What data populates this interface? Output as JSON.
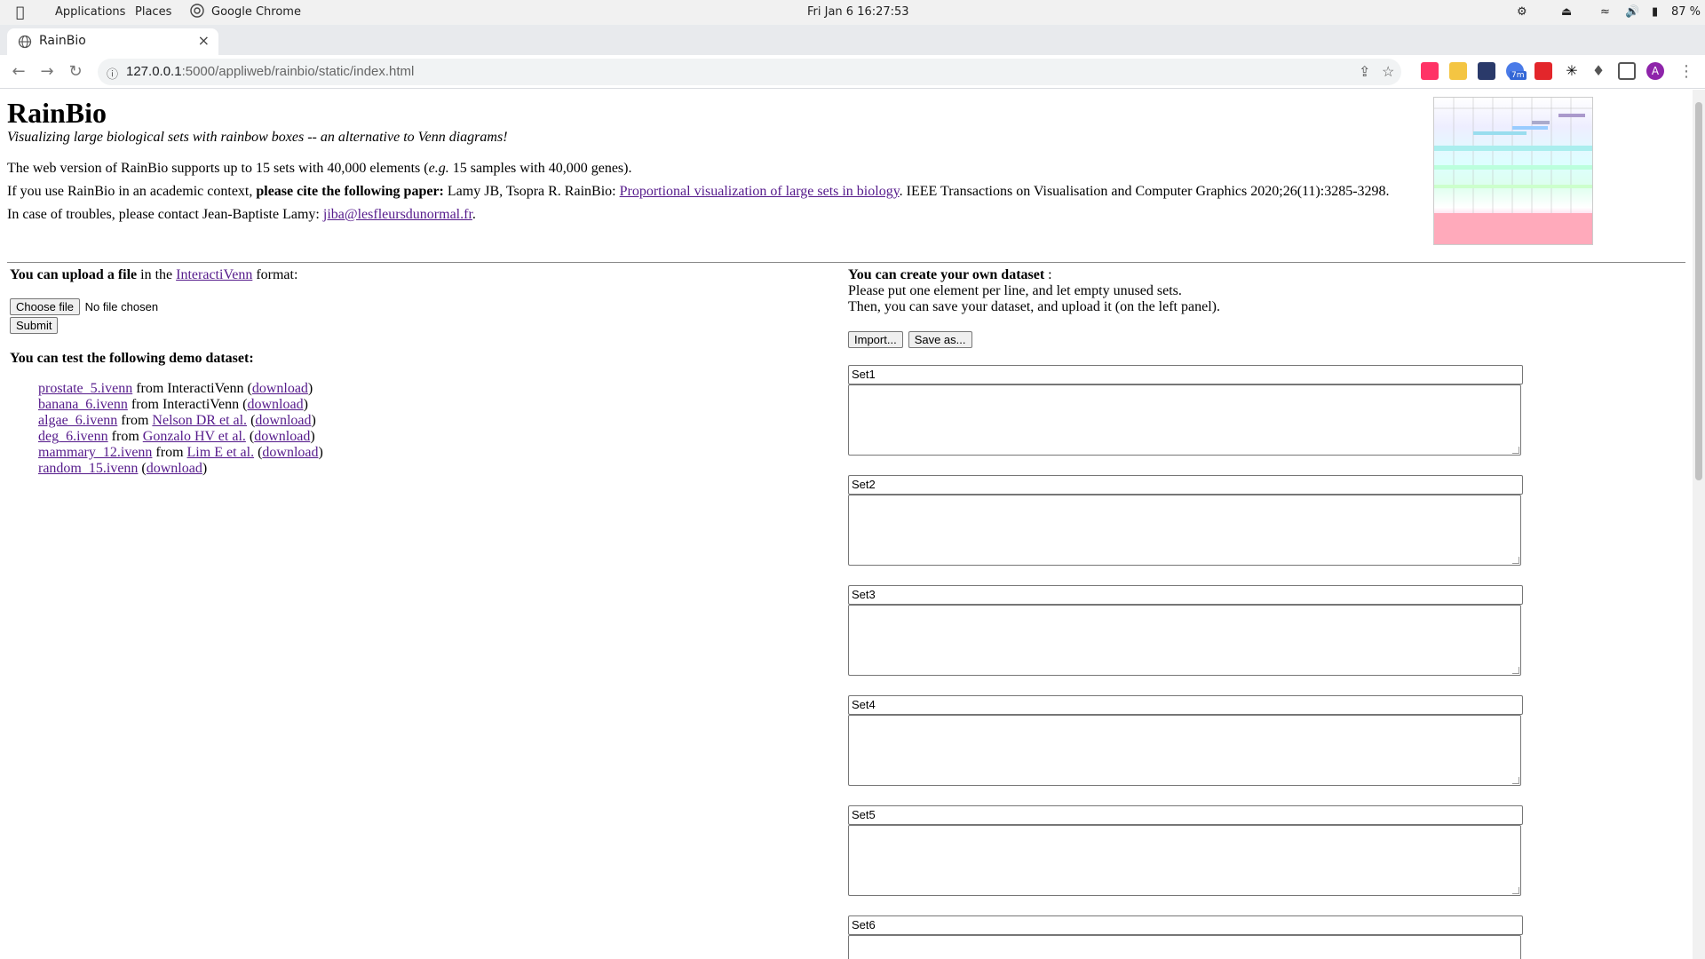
{
  "system": {
    "menus": [
      "Applications",
      "Places"
    ],
    "active_app": "Google Chrome",
    "datetime": "Fri Jan 6  16:27:53",
    "battery": "87 %"
  },
  "browser": {
    "tab_title": "RainBio",
    "url_host": "127.0.0.1",
    "url_rest": ":5000/appliweb/rainbio/static/index.html",
    "avatar_letter": "A",
    "ext_badge": "7m"
  },
  "page": {
    "title": "RainBio",
    "subtitle": "Visualizing large biological sets with rainbow boxes -- an alternative to Venn diagrams!",
    "p1_a": "The web version of RainBio supports up to 15 sets with 40,000 elements (",
    "p1_eg": "e.g.",
    "p1_b": " 15 samples with 40,000 genes).",
    "p2_a": "If you use RainBio in an academic context, ",
    "p2_bold": "please cite the following paper:",
    "p2_b": " Lamy JB, Tsopra R. RainBio: ",
    "p2_link": "Proportional visualization of large sets in biology",
    "p2_c": ". IEEE Transactions on Visualisation and Computer Graphics 2020;26(11):3285-3298.",
    "p3_a": "In case of troubles, please contact Jean-Baptiste Lamy: ",
    "p3_link": "jiba@lesfleursdunormal.fr",
    "p3_b": "."
  },
  "upload": {
    "lead_bold": "You can upload a file",
    "lead_a": " in the ",
    "lead_link": "InteractiVenn",
    "lead_b": " format:",
    "choose_label": "Choose file",
    "no_file": "No file chosen",
    "submit_label": "Submit"
  },
  "demo": {
    "heading": "You can test the following demo dataset:",
    "items": [
      {
        "name": "prostate_5.ivenn",
        "from": " from InteractiVenn (",
        "source_link": "",
        "dl": "download",
        "end": ")"
      },
      {
        "name": "banana_6.ivenn",
        "from": " from InteractiVenn (",
        "source_link": "",
        "dl": "download",
        "end": ")"
      },
      {
        "name": "algae_6.ivenn",
        "from": " from ",
        "source_link": "Nelson DR et al.",
        "dl": "download",
        "end": ")"
      },
      {
        "name": "deg_6.ivenn",
        "from": " from ",
        "source_link": "Gonzalo HV et al.",
        "dl": "download",
        "end": ")"
      },
      {
        "name": "mammary_12.ivenn",
        "from": " from ",
        "source_link": "Lim E et al.",
        "dl": "download",
        "end": ")"
      },
      {
        "name": "random_15.ivenn",
        "from": " (",
        "source_link": "",
        "dl": "download",
        "end": ")"
      }
    ]
  },
  "create": {
    "heading_bold": "You can create your own dataset",
    "heading_rest": " :",
    "line1": "Please put one element per line, and let empty unused sets.",
    "line2": "Then, you can save your dataset, and upload it (on the left panel).",
    "import_label": "Import...",
    "save_label": "Save as...",
    "sets": [
      "Set1",
      "Set2",
      "Set3",
      "Set4",
      "Set5",
      "Set6"
    ]
  }
}
